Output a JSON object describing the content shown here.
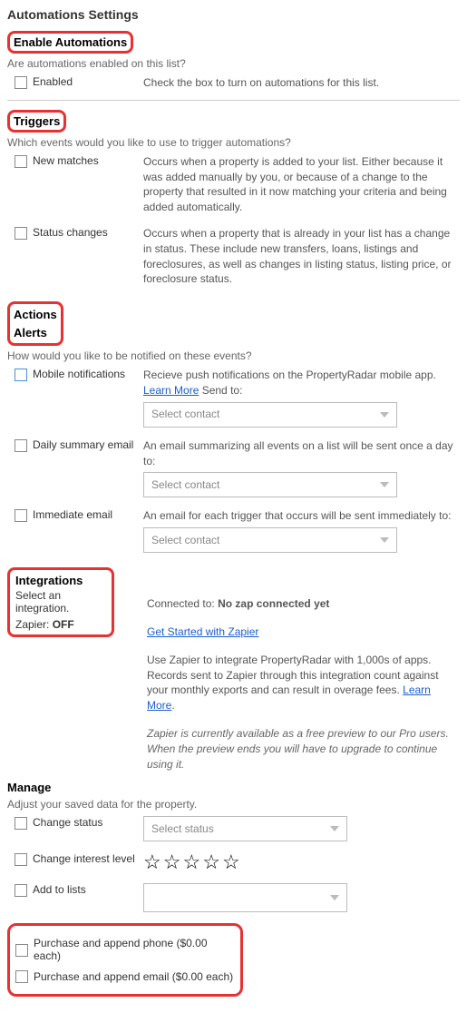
{
  "page_title": "Automations Settings",
  "enable": {
    "heading": "Enable Automations",
    "desc": "Are automations enabled on this list?",
    "checkbox_label": "Enabled",
    "right_text": "Check the box to turn on automations for this list."
  },
  "triggers": {
    "heading": "Triggers",
    "desc": "Which events would you like to use to trigger automations?",
    "items": [
      {
        "label": "New matches",
        "text": "Occurs when a property is added to your list. Either because it was added manually by you, or because of a change to the property that resulted in it now matching your criteria and being added automatically."
      },
      {
        "label": "Status changes",
        "text": "Occurs when a property that is already in your list has a change in status. These include new transfers, loans, listings and foreclosures, as well as changes in listing status, listing price, or foreclosure status."
      }
    ]
  },
  "actions": {
    "heading": "Actions",
    "alerts_heading": "Alerts",
    "desc": "How would you like to be notified on these events?",
    "mobile": {
      "label": "Mobile notifications",
      "text_pre": "Recieve push notifications on the PropertyRadar mobile app. ",
      "learn_more": "Learn More",
      "text_post": " Send to:",
      "placeholder": "Select contact"
    },
    "daily": {
      "label": "Daily summary email",
      "text": "An email summarizing all events on a list will be sent once a day to:",
      "placeholder": "Select contact"
    },
    "immediate": {
      "label": "Immediate email",
      "text": "An email for each trigger that occurs will be sent immediately to:",
      "placeholder": "Select contact"
    }
  },
  "integrations": {
    "heading": "Integrations",
    "sub": "Select an integration.",
    "zapier_label": "Zapier: ",
    "zapier_state": "OFF",
    "connected_pre": "Connected to: ",
    "connected_val": "No zap connected yet",
    "get_started": "Get Started with Zapier",
    "body_pre": "Use Zapier to integrate PropertyRadar with 1,000s of apps. Records sent to Zapier through this integration count against your monthly exports and can result in overage fees. ",
    "learn_more": "Learn More",
    "body_post": ".",
    "preview_note": "Zapier is currently available as a free preview to our Pro users. When the preview ends you will have to upgrade to continue using it."
  },
  "manage": {
    "heading": "Manage",
    "desc": "Adjust your saved data for the property.",
    "change_status": {
      "label": "Change status",
      "placeholder": "Select status"
    },
    "change_interest": {
      "label": "Change interest level"
    },
    "add_to_lists": {
      "label": "Add to lists"
    },
    "purchase_phone": "Purchase and append phone ($0.00 each)",
    "purchase_email": "Purchase and append email ($0.00 each)"
  }
}
